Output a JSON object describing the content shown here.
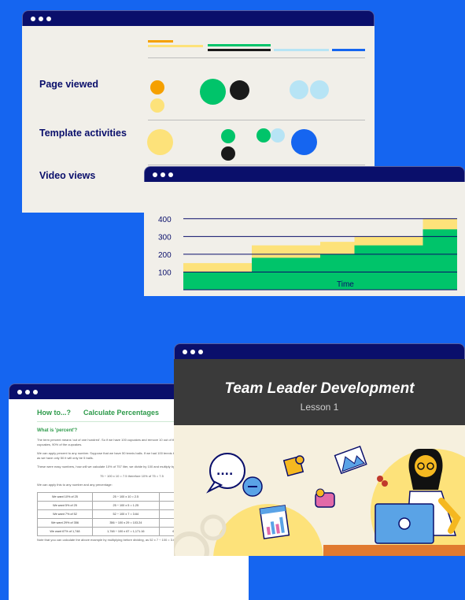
{
  "analytics_window": {
    "metrics": [
      {
        "label": "Page viewed"
      },
      {
        "label": "Template activities"
      },
      {
        "label": "Video views"
      }
    ],
    "colors": {
      "orange": "#f5a000",
      "yellow": "#fde27a",
      "green": "#00c46a",
      "black": "#1a1a1a",
      "light_blue": "#b7e4f5",
      "blue": "#1565f0"
    }
  },
  "chart_window": {
    "chart_data": {
      "type": "area",
      "xlabel": "Time",
      "ylabel": "",
      "y_ticks": [
        100,
        200,
        300,
        400
      ],
      "ylim": [
        0,
        430
      ],
      "x": [
        0,
        1,
        2,
        3,
        4,
        5,
        6,
        7,
        8
      ],
      "series": [
        {
          "color": "#fde27a",
          "values": [
            150,
            150,
            250,
            250,
            270,
            300,
            300,
            400,
            400
          ]
        },
        {
          "color": "#00c46a",
          "values": [
            100,
            100,
            180,
            180,
            200,
            250,
            250,
            340,
            340
          ]
        }
      ]
    }
  },
  "document_window": {
    "header_left": "How to...?",
    "header_right": "Calculate Percentages",
    "subheading": "What is 'percent'?",
    "paragraphs": [
      "The term percent means 'out of one hundred'. So if we have 100 cupcakes and remove 10 out of the 100 cupcakes. What is left is 90 cupcakes, 90% of the cupcakes.",
      "We can apply percent to any number. Suppose that we have 50 tennis balls. If we had 100 tennis balls then 10% would be 10 balls, but as we have only 50 it will only be 5 balls.",
      "These were easy numbers, how will we calculate 10% of 757 liter, we divide by 100 and multiply by 10."
    ],
    "formula": "75 ÷ 100 x 10 = 7.5 therefore 10% of 75 = 7.5",
    "apply_text": "We can apply this to any number and any percentage:",
    "table": [
      [
        "We want 10% of 25",
        "25 ÷ 100 x 10 = 2.5",
        "10% of 25 is 2.5"
      ],
      [
        "We want 5% of 25",
        "25 ÷ 100 x 5 = 1.25",
        "5% of 25 is 1.25"
      ],
      [
        "We want 7% of 52",
        "52 ÷ 100 x 7 = 3.64",
        "7% of 52 is 3.64"
      ],
      [
        "We want 29% of 356",
        "356 ÷ 100 x 29 = 103.24",
        "29% of 356 is 103.24"
      ],
      [
        "We want 67% of 1,748",
        "1,748 ÷ 100 x 67 = 1,171.16",
        "67% of 1,748 is 1,171.16"
      ]
    ],
    "note": "Note that you can calculate the above example by multiplying before dividing, as 52 x 7 ÷ 100 = 3.64"
  },
  "course_window": {
    "title": "Team Leader Development",
    "subtitle": "Lesson 1",
    "speech_bubble": "....",
    "icons": [
      "puzzle-icon",
      "mountain-icon",
      "wallet-icon",
      "chart-card-icon",
      "laptop-icon",
      "speech-bubble-icon"
    ]
  }
}
